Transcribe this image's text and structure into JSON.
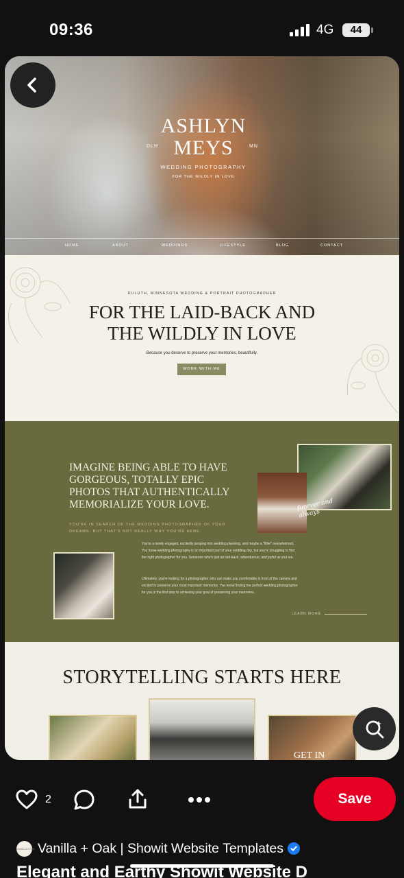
{
  "status_bar": {
    "time": "09:36",
    "network": "4G",
    "battery": "44"
  },
  "pin_image": {
    "hero": {
      "brand_line1": "ASHLYN",
      "brand_line2": "MEYS",
      "location_left": "DLH",
      "location_right": "MN",
      "subtitle": "WEDDING PHOTOGRAPHY",
      "tagline": "FOR THE WILDLY IN LOVE",
      "nav": [
        "HOME",
        "ABOUT",
        "WEDDINGS",
        "LIFESTYLE",
        "BLOG",
        "CONTACT"
      ]
    },
    "intro": {
      "kicker": "DULUTH, MINNESOTA WEDDING & PORTRAIT PHOTOGRAPHER",
      "headline_line1": "FOR THE LAID-BACK AND",
      "headline_line2": "THE WILDLY IN LOVE",
      "lede": "Because you deserve to preserve your memories, beautifully.",
      "cta": "WORK WITH ME"
    },
    "about": {
      "headline": "IMAGINE BEING ABLE TO HAVE GORGEOUS, TOTALLY EPIC PHOTOS THAT AUTHENTICALLY MEMORIALIZE YOUR LOVE.",
      "subhead": "YOU'RE IN SEARCH OF THE WEDDING PHOTOGRAPHER OF YOUR DREAMS, BUT THAT'S NOT REALLY WHY YOU'RE HERE.",
      "paragraph1": "You're a newly engaged, excitedly jumping into wedding planning, and maybe a *little* overwhelmed. You know wedding photography is an important part of your wedding day, but you're struggling to find the right photographer for you. Someone who's just as laid-back, adventurous, and joyful as you are.",
      "paragraph2": "Ultimately, you're looking for a photographer who can make you comfortable in front of the camera and excited to preserve your most important memories. You know finding the perfect wedding photographer for you is the first step to achieving your goal of preserving your memories.",
      "script_line1": "forever and",
      "script_line2": "always",
      "learn_more": "LEARN MORE"
    },
    "story": {
      "title": "STORYTELLING STARTS HERE",
      "thumb_text": "GET IN"
    }
  },
  "actions": {
    "like_count": "2",
    "save_label": "Save"
  },
  "creator": {
    "avatar_text": "VANILLA+OAK",
    "name": "Vanilla + Oak | Showit Website Templates"
  },
  "pin_title": "Elegant and Earthy Showit Website D",
  "colors": {
    "accent": "#e60023",
    "olive": "#6a6a3f",
    "cream": "#f4f1e8",
    "verified": "#1d7bf2"
  },
  "icons": [
    "back-icon",
    "heart-icon",
    "comment-icon",
    "share-icon",
    "more-icon",
    "visual-search-icon",
    "verified-icon",
    "signal-icon"
  ]
}
